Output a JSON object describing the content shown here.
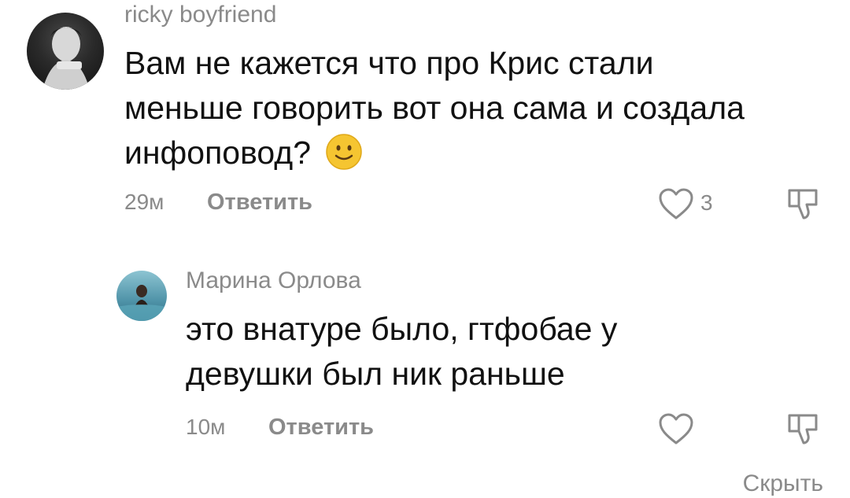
{
  "comments": [
    {
      "username": "ricky boyfriend",
      "text": "Вам не кажется что про Крис стали меньше говорить вот она сама и создала инфоповод?",
      "emoji": "slightly-smiling-face-emoji",
      "time": "29м",
      "reply_label": "Ответить",
      "likes": "3"
    },
    {
      "username": "Марина Орлова",
      "text": "это внатуре было, гтфобае у девушки был ник раньше",
      "time": "10м",
      "reply_label": "Ответить",
      "likes": ""
    }
  ],
  "hide_label": "Скрыть",
  "colors": {
    "text": "#111111",
    "muted": "#8a8a8a",
    "emoji": "#f5c531"
  }
}
